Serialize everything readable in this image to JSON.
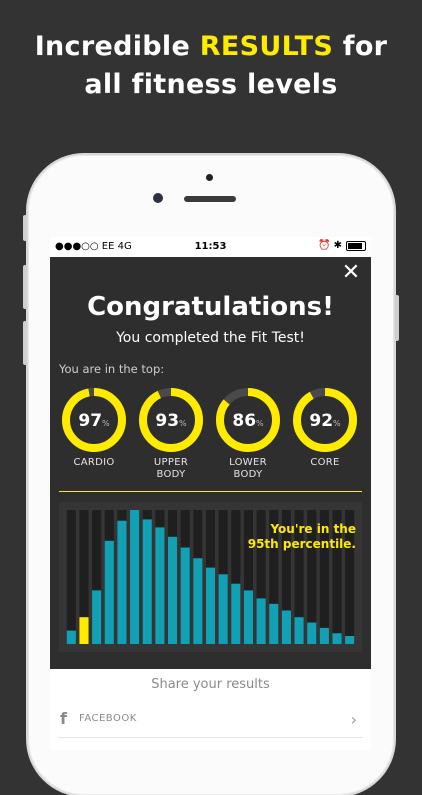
{
  "promo": {
    "line1_before": "Incredible ",
    "line1_highlight": "RESULTS",
    "line1_after": " for",
    "line2": "all fitness levels",
    "highlight_color": "#FFEB00"
  },
  "status_bar": {
    "carrier": "●●●○○ EE  4G",
    "time": "11:53",
    "right_icons": "⏰ ✱"
  },
  "close_icon": "✕",
  "results": {
    "title": "Congratulations!",
    "subtitle": "You completed the Fit Test!",
    "top_label": "You are in the top:",
    "scores": [
      {
        "value": "97",
        "unit": "%",
        "label": "CARDIO",
        "fraction": 0.97
      },
      {
        "value": "93",
        "unit": "%",
        "label": "UPPER\nBODY",
        "fraction": 0.93
      },
      {
        "value": "86",
        "unit": "%",
        "label": "LOWER\nBODY",
        "fraction": 0.86
      },
      {
        "value": "92",
        "unit": "%",
        "label": "CORE",
        "fraction": 0.92
      }
    ]
  },
  "chart_data": {
    "type": "bar",
    "title": "",
    "annotation": "You're in the\n95th percentile.",
    "values": [
      10,
      20,
      40,
      77,
      92,
      100,
      93,
      87,
      80,
      72,
      64,
      57,
      52,
      45,
      40,
      34,
      30,
      25,
      20,
      16,
      12,
      8,
      6
    ],
    "highlight_index": 1,
    "ylim": [
      0,
      100
    ],
    "colors": {
      "bar": "#12A0B4",
      "highlight": "#FFEB00",
      "track": "#1f1f1f"
    }
  },
  "share": {
    "title": "Share your results",
    "facebook_label": "FACEBOOK",
    "facebook_icon": "f",
    "chevron": "›"
  }
}
